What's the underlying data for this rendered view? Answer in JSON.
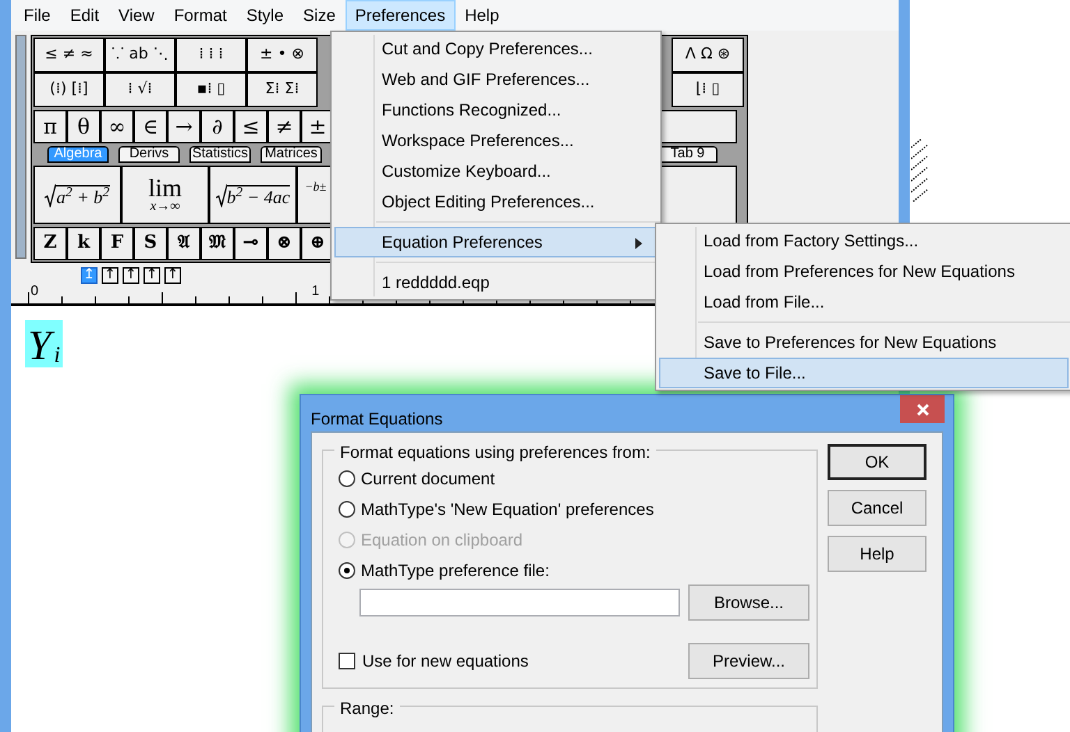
{
  "menubar": [
    {
      "label": "File",
      "selected": false
    },
    {
      "label": "Edit",
      "selected": false
    },
    {
      "label": "View",
      "selected": false
    },
    {
      "label": "Format",
      "selected": false
    },
    {
      "label": "Style",
      "selected": false
    },
    {
      "label": "Size",
      "selected": false
    },
    {
      "label": "Preferences",
      "selected": true
    },
    {
      "label": "Help",
      "selected": false
    }
  ],
  "palette": {
    "top_rows": [
      {
        "left": [
          "≤ ≠ ≈",
          "⸪ ab ⋱",
          "⁞ ⁞ ⁞",
          "± • ⊗"
        ],
        "right": [
          "Λ Ω ⊛"
        ]
      },
      {
        "left": [
          "(⁞) [⁞]",
          "⁞ √⁞",
          "▪⁞ ▯",
          "Σ⁞ Σ⁞"
        ],
        "right": [
          "⌊⁞ ▯"
        ]
      }
    ],
    "symbol_row": [
      "π",
      "θ",
      "∞",
      "∈",
      "→",
      "∂",
      "≤",
      "≠",
      "±"
    ],
    "tabs": [
      {
        "label": "Algebra",
        "selected": true
      },
      {
        "label": "Derivs",
        "selected": false
      },
      {
        "label": "Statistics",
        "selected": false
      },
      {
        "label": "Matrices",
        "selected": false
      }
    ],
    "far_tabs": [
      {
        "label": "Tab 9",
        "selected": false
      }
    ],
    "templates": [
      {
        "kind": "root",
        "body": "a$^{2}$ + b$^{2}$"
      },
      {
        "kind": "limit",
        "top": "lim",
        "bottom": "x→∞"
      },
      {
        "kind": "root",
        "body": "b$^{2}$ − 4ac"
      },
      {
        "kind": "plain",
        "body": "−b±"
      }
    ],
    "letter_row": [
      "Z",
      "k",
      "F",
      "S",
      "𝔄",
      "𝔐",
      "⊸",
      "⊗",
      "⊕"
    ]
  },
  "nudge_buttons": [
    {
      "label": "↥",
      "selected": true
    },
    {
      "label": "↑",
      "selected": false
    },
    {
      "label": "↑",
      "selected": false
    },
    {
      "label": "↑",
      "selected": false
    },
    {
      "label": "↑",
      "selected": false
    }
  ],
  "ruler": {
    "labels": [
      "0",
      "1"
    ]
  },
  "equation": {
    "base": "Y",
    "subscript": "i",
    "selected": true
  },
  "menu": {
    "groups": [
      [
        {
          "label": "Cut and Copy Preferences...",
          "selected": false,
          "submenu": false
        },
        {
          "label": "Web and GIF Preferences...",
          "selected": false,
          "submenu": false
        },
        {
          "label": "Functions Recognized...",
          "selected": false,
          "submenu": false
        },
        {
          "label": "Workspace Preferences...",
          "selected": false,
          "submenu": false
        },
        {
          "label": "Customize Keyboard...",
          "selected": false,
          "submenu": false
        },
        {
          "label": "Object Editing Preferences...",
          "selected": false,
          "submenu": false
        }
      ],
      [
        {
          "label": "Equation Preferences",
          "selected": true,
          "submenu": true
        }
      ],
      [
        {
          "label": "1 reddddd.eqp",
          "selected": false,
          "submenu": false
        }
      ]
    ]
  },
  "submenu": {
    "groups": [
      [
        {
          "label": "Load from Factory Settings...",
          "selected": false
        },
        {
          "label": "Load from Preferences for New Equations",
          "selected": false
        },
        {
          "label": "Load from File...",
          "selected": false
        }
      ],
      [
        {
          "label": "Save to Preferences for New Equations",
          "selected": false
        },
        {
          "label": "Save to File...",
          "selected": true
        }
      ]
    ]
  },
  "dialog": {
    "title": "Format Equations",
    "source_group": {
      "title": "Format equations using preferences from:",
      "options": [
        {
          "label": "Current document",
          "selected": false,
          "disabled": false
        },
        {
          "label": "MathType's 'New Equation' preferences",
          "selected": false,
          "disabled": false
        },
        {
          "label": "Equation on clipboard",
          "selected": false,
          "disabled": true
        },
        {
          "label": "MathType preference file:",
          "selected": true,
          "disabled": false
        }
      ],
      "browse_button": "Browse...",
      "checkbox": {
        "label": "Use for new equations",
        "checked": false
      },
      "preview_button": "Preview..."
    },
    "buttons": [
      {
        "label": "OK",
        "default": true
      },
      {
        "label": "Cancel",
        "default": false
      },
      {
        "label": "Help",
        "default": false
      }
    ],
    "range_group": {
      "title": "Range:"
    }
  }
}
